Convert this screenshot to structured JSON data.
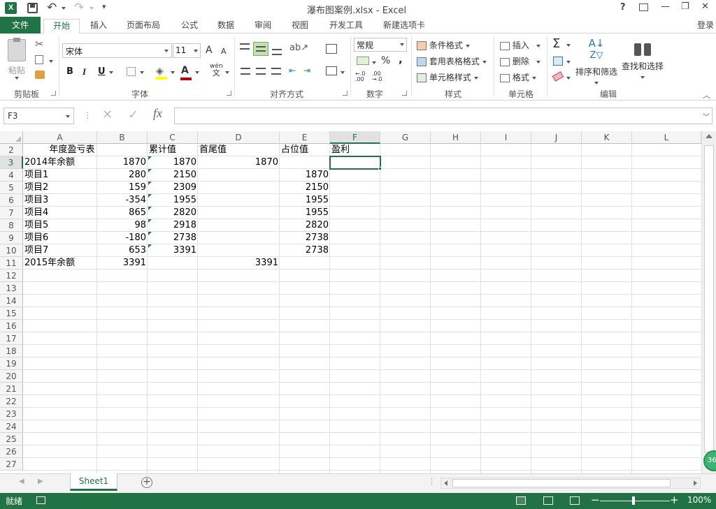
{
  "window": {
    "title": "瀑布图案例.xlsx - Excel",
    "help": "?",
    "min": "—",
    "max": "❐",
    "close": "✕",
    "login": "登录"
  },
  "tabs": [
    "文件",
    "开始",
    "插入",
    "页面布局",
    "公式",
    "数据",
    "审阅",
    "视图",
    "开发工具",
    "新建选项卡"
  ],
  "ribbon": {
    "clipboard": {
      "paste": "粘贴",
      "label": "剪贴板"
    },
    "font": {
      "name": "宋体",
      "size": "11",
      "bold": "B",
      "italic": "I",
      "underline": "U",
      "grow": "A",
      "shrink": "A",
      "wen": "wén",
      "wen2": "文",
      "label": "字体"
    },
    "align": {
      "label": "对齐方式"
    },
    "number": {
      "format": "常规",
      "percent": "%",
      "comma": ",",
      "inc": "←.0 .00",
      "dec": ".00 →.0",
      "label": "数字"
    },
    "styles": {
      "cond": "条件格式",
      "table": "套用表格格式",
      "cell": "单元格样式",
      "label": "样式"
    },
    "cells": {
      "insert": "插入",
      "delete": "删除",
      "format": "格式",
      "label": "单元格"
    },
    "editing": {
      "sort": "排序和筛选",
      "find": "查找和选择",
      "label": "编辑"
    }
  },
  "namebox": "F3",
  "formula": "",
  "columns": [
    "A",
    "B",
    "C",
    "D",
    "E",
    "F",
    "G",
    "H",
    "I",
    "J",
    "K",
    "L"
  ],
  "rows": [
    "2",
    "3",
    "4",
    "5",
    "6",
    "7",
    "8",
    "9",
    "10",
    "11",
    "12",
    "13",
    "14",
    "15",
    "16",
    "17",
    "18",
    "19",
    "20",
    "21",
    "22",
    "23",
    "24",
    "25",
    "26",
    "27"
  ],
  "header": {
    "a": "年度盈亏表",
    "c": "累计值",
    "d": "首尾值",
    "e": "占位值",
    "f": "盈利"
  },
  "data": [
    {
      "a": "2014年余额",
      "b": "1870",
      "c": "1870",
      "d": "1870",
      "e": ""
    },
    {
      "a": "项目1",
      "b": "280",
      "c": "2150",
      "d": "",
      "e": "1870"
    },
    {
      "a": "项目2",
      "b": "159",
      "c": "2309",
      "d": "",
      "e": "2150"
    },
    {
      "a": "项目3",
      "b": "-354",
      "c": "1955",
      "d": "",
      "e": "1955"
    },
    {
      "a": "项目4",
      "b": "865",
      "c": "2820",
      "d": "",
      "e": "1955"
    },
    {
      "a": "项目5",
      "b": "98",
      "c": "2918",
      "d": "",
      "e": "2820"
    },
    {
      "a": "项目6",
      "b": "-180",
      "c": "2738",
      "d": "",
      "e": "2738"
    },
    {
      "a": "项目7",
      "b": "653",
      "c": "3391",
      "d": "",
      "e": "2738"
    },
    {
      "a": "2015年余额",
      "b": "3391",
      "c": "",
      "d": "3391",
      "e": ""
    }
  ],
  "sheet": {
    "name": "Sheet1",
    "add": "+"
  },
  "status": {
    "ready": "就绪",
    "zoom": "100%",
    "badge": "36"
  },
  "colors": {
    "accent": "#217346",
    "selection": "#217346"
  }
}
